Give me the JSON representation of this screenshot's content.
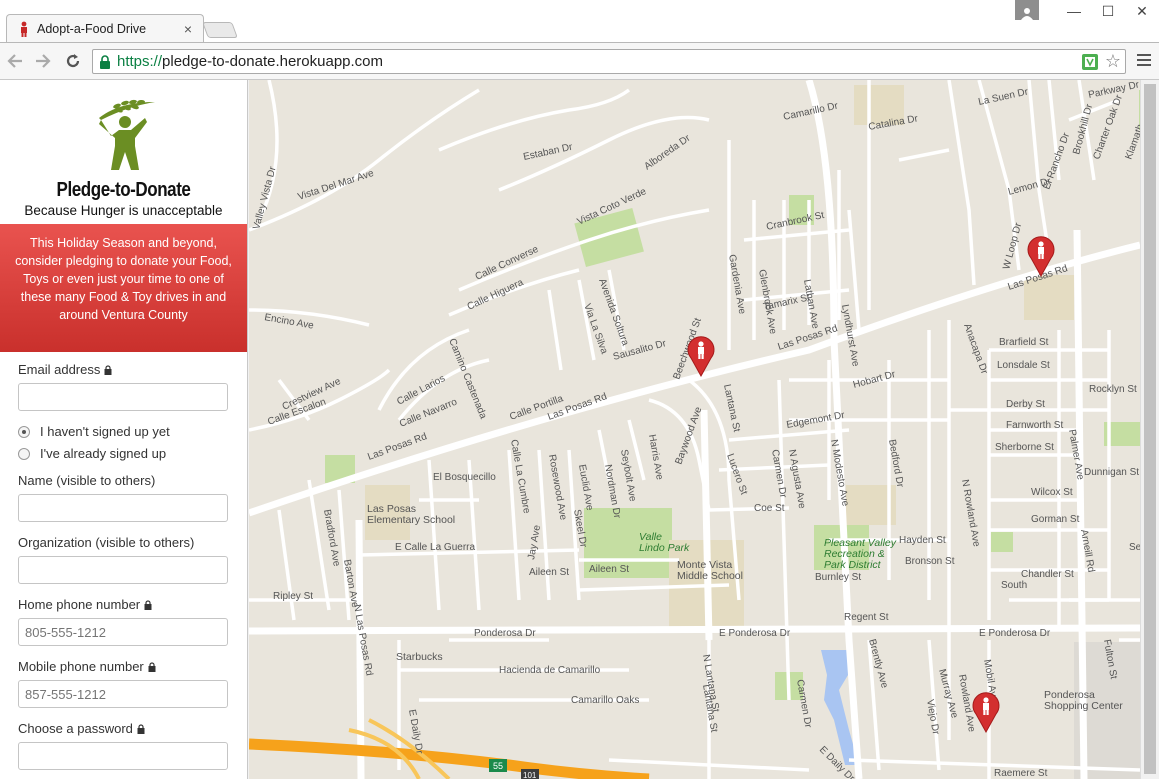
{
  "browser": {
    "tab_title": "Adopt-a-Food Drive",
    "tab_close": "×",
    "url_scheme": "https://",
    "url_host": "pledge-to-donate.herokuapp.com",
    "minimize": "—",
    "maximize": "☐",
    "close": "✕",
    "star": "☆"
  },
  "sidebar": {
    "logo_title": "Pledge-to-Donate",
    "logo_tagline": "Because Hunger is unacceptable",
    "banner_text": "This Holiday Season and beyond, consider pledging to donate your Food, Toys or even just your time to one of these many Food & Toy drives in and around Ventura County",
    "accent_color": "#d9534f",
    "form": {
      "email_label": "Email address",
      "radio_not_signed_up": "I haven't signed up yet",
      "radio_signed_up": "I've already signed up",
      "radio_selected": "not_signed_up",
      "name_label": "Name (visible to others)",
      "organization_label": "Organization (visible to others)",
      "home_phone_label": "Home phone number",
      "home_phone_placeholder": "805-555-1212",
      "mobile_phone_label": "Mobile phone number",
      "mobile_phone_placeholder": "857-555-1212",
      "password_label": "Choose a password"
    }
  },
  "map": {
    "streets": [
      "Las Posas Rd",
      "Las Posas Rd",
      "Las Posas Rd",
      "Las Posas Rd",
      "Ponderosa Dr",
      "E Ponderosa Dr",
      "E Ponderosa Dr",
      "Camarillo Dr",
      "Catalina Dr",
      "La Suen Dr",
      "Parkway Dr",
      "Brookhill Dr",
      "Charter Oak Dr",
      "Klamath",
      "El Rancho Dr",
      "Lemon Dr",
      "W Loop Dr",
      "Estaban Dr",
      "Alboreda Dr",
      "Vista Del Mar Ave",
      "Valley Vista Dr",
      "Vista Coto Verde",
      "Gardenia Ave",
      "Glenbrook Ave",
      "Cranbrook St",
      "Lathan Ave",
      "Lyndhurst Ave",
      "Tamarix St",
      "Calle Converse",
      "Calle Higuera",
      "Avenida Soltura",
      "Via La Silva",
      "Sausalito Dr",
      "Encino Ave",
      "Camino Castenada",
      "Calle Larios",
      "Calle Navarro",
      "Calle Portilla",
      "Beechwood St",
      "Lantana St",
      "Anacapa Dr",
      "Brarfield St",
      "Lonsdale St",
      "Rocklyn St",
      "Hobart Dr",
      "Edgemont Dr",
      "Derby St",
      "Farnworth St",
      "Sherborne St",
      "Palmer Ave",
      "Dunnigan St",
      "Crestview Ave",
      "Calle Escalon",
      "Calle La Cumbre",
      "Rosewood Ave",
      "Euclid Ave",
      "Nordman Dr",
      "Harris Ave",
      "Seybolt Ave",
      "Baywood Ave",
      "Lucero St",
      "N Agusta Ave",
      "Carmen Dr",
      "N Modesto Ave",
      "Bedford Dr",
      "N Rowland Ave",
      "Wilcox St",
      "Gorman St",
      "Arneill Rd",
      "El Bosquecillo",
      "Coe St",
      "Hayden St",
      "Bronson St",
      "Burnley St",
      "Chandler St",
      "South",
      "Bradford Ave",
      "Barton Ave",
      "E Calle La Guerra",
      "Jay Ave",
      "Skeel Dr",
      "Aileen St",
      "Aileen St",
      "Ripley St",
      "N Las Posas Rd",
      "Regent St",
      "Hacienda de Camarillo",
      "Camarillo Oaks",
      "N Lantana St",
      "Lantana St",
      "Carmen Dr",
      "Brently Ave",
      "Murray Ave",
      "Viejo Dr",
      "Rowland Ave",
      "Mobil Ave",
      "E Daily Dr",
      "E Daily Dr",
      "Raemere St",
      "Fulton St",
      "Se"
    ],
    "places": [
      "Las Posas Elementary School",
      "Valle Lindo Park",
      "Monte Vista Middle School",
      "Pleasant Valley Recreation & Park District",
      "Starbucks",
      "Ponderosa Shopping Center"
    ],
    "highway_shield": "55",
    "highway_shield_2": "101"
  }
}
